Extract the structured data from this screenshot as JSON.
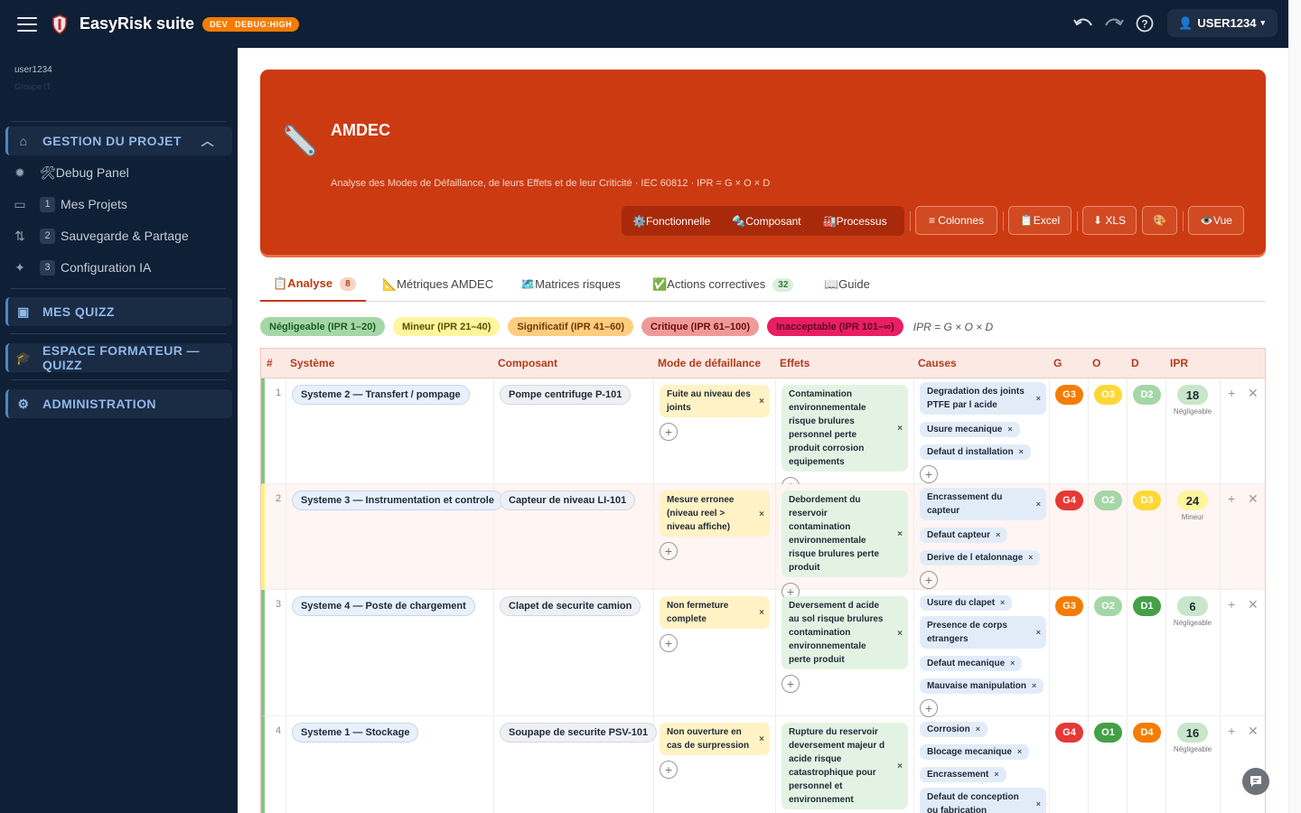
{
  "app": {
    "title": "EasyRisk suite",
    "env": "DEV",
    "debug": "DEBUG:HIGH",
    "user": "USER1234"
  },
  "sidebar": {
    "user": "user1234",
    "user_sub": "Groupe IT",
    "sections": [
      {
        "label": "GESTION DU PROJET",
        "icon": "home-icon"
      },
      {
        "label": "MES QUIZZ",
        "icon": "quiz-icon"
      },
      {
        "label": "ESPACE FORMATEUR — QUIZZ",
        "icon": "graduation-cap-icon"
      },
      {
        "label": "ADMINISTRATION",
        "icon": "admin-icon"
      }
    ],
    "items": [
      {
        "label": "🛠Debug Panel",
        "num": ""
      },
      {
        "label": "Mes Projets",
        "num": "1"
      },
      {
        "label": "Sauvegarde & Partage",
        "num": "2"
      },
      {
        "label": "Configuration IA",
        "num": "3"
      }
    ]
  },
  "banner": {
    "title": "AMDEC",
    "subtitle": "Analyse des Modes de Défaillance, de leurs Effets et de leur Criticité · IEC 60812 · IPR = G × O × D",
    "views": [
      "⚙️Fonctionnelle",
      "🔩Composant",
      "🏭Processus"
    ],
    "buttons": {
      "colonnes": "≡ Colonnes",
      "excel": "📋Excel",
      "xls": "⬇ XLS",
      "palette": "🎨",
      "vue": "👁️Vue"
    }
  },
  "tabs": [
    {
      "label": "📋Analyse",
      "count": "8"
    },
    {
      "label": "📐Métriques AMDEC",
      "count": ""
    },
    {
      "label": "🗺️Matrices risques",
      "count": ""
    },
    {
      "label": "✅Actions correctives",
      "count": "32"
    },
    {
      "label": "📖Guide",
      "count": ""
    }
  ],
  "legend": {
    "items": [
      {
        "label": "Négligeable (IPR 1–20)",
        "color": "#a5d6a7"
      },
      {
        "label": "Mineur (IPR 21–40)",
        "color": "#fff59d"
      },
      {
        "label": "Significatif (IPR 41–60)",
        "color": "#ffcc80"
      },
      {
        "label": "Critique (IPR 61–100)",
        "color": "#ef9a9a"
      },
      {
        "label": "Inacceptable (IPR 101–∞)",
        "color": "#e91e63"
      }
    ],
    "formula": "IPR = G × O × D"
  },
  "table": {
    "headers": [
      "#",
      "Système",
      "Composant",
      "Mode de défaillance",
      "Effets",
      "Causes",
      "G",
      "O",
      "D",
      "IPR"
    ],
    "rows": [
      {
        "n": "1",
        "systeme": "Systeme 2 — Transfert / pompage",
        "composant": "Pompe centrifuge P-101",
        "mode": "Fuite au niveau des joints",
        "effet": "Contamination environnementale risque brulures personnel perte produit corrosion equipements",
        "causes": [
          "Degradation des joints PTFE par l acide",
          "Usure mecanique",
          "Defaut d installation"
        ],
        "g": "G3",
        "o": "O3",
        "d": "D2",
        "ipr": "18",
        "ipr_label": "Négligeable"
      },
      {
        "n": "2",
        "systeme": "Systeme 3 — Instrumentation et controle",
        "composant": "Capteur de niveau LI-101",
        "mode": "Mesure erronee (niveau reel > niveau affiche)",
        "effet": "Debordement du reservoir contamination environnementale risque brulures perte produit",
        "causes": [
          "Encrassement du capteur",
          "Defaut capteur",
          "Derive de l etalonnage"
        ],
        "g": "G4",
        "o": "O2",
        "d": "D3",
        "ipr": "24",
        "ipr_label": "Mineur"
      },
      {
        "n": "3",
        "systeme": "Systeme 4 — Poste de chargement",
        "composant": "Clapet de securite camion",
        "mode": "Non fermeture complete",
        "effet": "Deversement d acide au sol risque brulures contamination environnementale perte produit",
        "causes": [
          "Usure du clapet",
          "Presence de corps etrangers",
          "Defaut mecanique",
          "Mauvaise manipulation"
        ],
        "g": "G3",
        "o": "O2",
        "d": "D1",
        "ipr": "6",
        "ipr_label": "Négligeable"
      },
      {
        "n": "4",
        "systeme": "Systeme 1 — Stockage",
        "composant": "Soupape de securite PSV-101",
        "mode": "Non ouverture en cas de surpression",
        "effet": "Rupture du reservoir deversement majeur d acide risque catastrophique pour personnel et environnement",
        "causes": [
          "Corrosion",
          "Blocage mecanique",
          "Encrassement",
          "Defaut de conception ou fabrication"
        ],
        "g": "G4",
        "o": "O1",
        "d": "D4",
        "ipr": "16",
        "ipr_label": "Négligeable"
      }
    ]
  }
}
